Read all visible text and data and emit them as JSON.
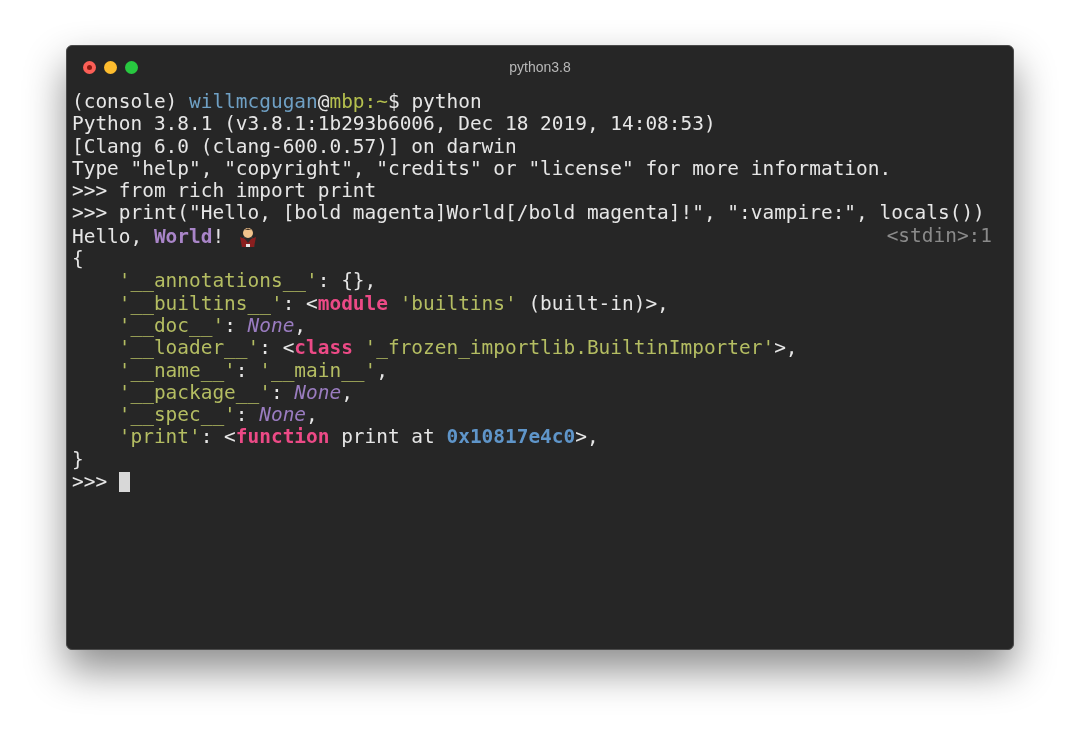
{
  "window": {
    "title": "python3.8"
  },
  "terminal": {
    "lines": [
      {
        "segments": [
          {
            "kind": "plain",
            "text": "(console) "
          },
          {
            "kind": "user",
            "text": "willmcgugan"
          },
          {
            "kind": "plain",
            "text": "@"
          },
          {
            "kind": "host",
            "text": "mbp:~"
          },
          {
            "kind": "plain",
            "text": "$ python"
          }
        ]
      },
      {
        "segments": [
          {
            "kind": "plain",
            "text": "Python 3.8.1 (v3.8.1:1b293b6006, Dec 18 2019, 14:08:53)"
          }
        ]
      },
      {
        "segments": [
          {
            "kind": "plain",
            "text": "[Clang 6.0 (clang-600.0.57)] on darwin"
          }
        ]
      },
      {
        "segments": [
          {
            "kind": "plain",
            "text": "Type \"help\", \"copyright\", \"credits\" or \"license\" for more information."
          }
        ]
      },
      {
        "segments": [
          {
            "kind": "plain",
            "text": ">>> from rich import print"
          }
        ]
      },
      {
        "segments": [
          {
            "kind": "plain",
            "text": ">>> print(\"Hello, [bold magenta]World[/bold magenta]!\", \":vampire:\", locals())"
          }
        ]
      },
      {
        "segments": [
          {
            "kind": "plain",
            "text": "Hello, "
          },
          {
            "kind": "bold_magenta",
            "text": "World"
          },
          {
            "kind": "plain",
            "text": "! "
          },
          {
            "kind": "emoji"
          }
        ],
        "location": "<stdin>:1"
      },
      {
        "segments": [
          {
            "kind": "plain",
            "text": "{"
          }
        ]
      },
      {
        "indented": true,
        "segments": [
          {
            "kind": "string",
            "text": "'__annotations__'"
          },
          {
            "kind": "plain",
            "text": ": {},"
          }
        ]
      },
      {
        "indented": true,
        "segments": [
          {
            "kind": "string",
            "text": "'__builtins__'"
          },
          {
            "kind": "plain",
            "text": ": <"
          },
          {
            "kind": "keyword",
            "text": "module"
          },
          {
            "kind": "string",
            "text": "'builtins'",
            "gap_before": true
          },
          {
            "kind": "plain",
            "text": " (built-in)>,"
          }
        ]
      },
      {
        "indented": true,
        "segments": [
          {
            "kind": "string",
            "text": "'__doc__'"
          },
          {
            "kind": "plain",
            "text": ": "
          },
          {
            "kind": "none",
            "text": "None"
          },
          {
            "kind": "plain",
            "text": ","
          }
        ]
      },
      {
        "indented": true,
        "segments": [
          {
            "kind": "string",
            "text": "'__loader__'"
          },
          {
            "kind": "plain",
            "text": ": <"
          },
          {
            "kind": "keyword",
            "text": "class"
          },
          {
            "kind": "string",
            "text": "'_frozen_importlib.BuiltinImporter'",
            "gap_before": true
          },
          {
            "kind": "plain",
            "text": ">,"
          }
        ]
      },
      {
        "indented": true,
        "segments": [
          {
            "kind": "string",
            "text": "'__name__'"
          },
          {
            "kind": "plain",
            "text": ": "
          },
          {
            "kind": "string",
            "text": "'__main__'"
          },
          {
            "kind": "plain",
            "text": ","
          }
        ]
      },
      {
        "indented": true,
        "segments": [
          {
            "kind": "string",
            "text": "'__package__'"
          },
          {
            "kind": "plain",
            "text": ": "
          },
          {
            "kind": "none",
            "text": "None"
          },
          {
            "kind": "plain",
            "text": ","
          }
        ]
      },
      {
        "indented": true,
        "segments": [
          {
            "kind": "string",
            "text": "'__spec__'"
          },
          {
            "kind": "plain",
            "text": ": "
          },
          {
            "kind": "none",
            "text": "None"
          },
          {
            "kind": "plain",
            "text": ","
          }
        ]
      },
      {
        "indented": true,
        "segments": [
          {
            "kind": "string",
            "text": "'print'"
          },
          {
            "kind": "plain",
            "text": ": <"
          },
          {
            "kind": "keyword",
            "text": "function"
          },
          {
            "kind": "plain",
            "text": " print at "
          },
          {
            "kind": "number",
            "text": "0x10817e4c0"
          },
          {
            "kind": "plain",
            "text": ">,"
          }
        ]
      },
      {
        "segments": [
          {
            "kind": "plain",
            "text": "}"
          }
        ]
      }
    ],
    "prompt": ">>> "
  }
}
